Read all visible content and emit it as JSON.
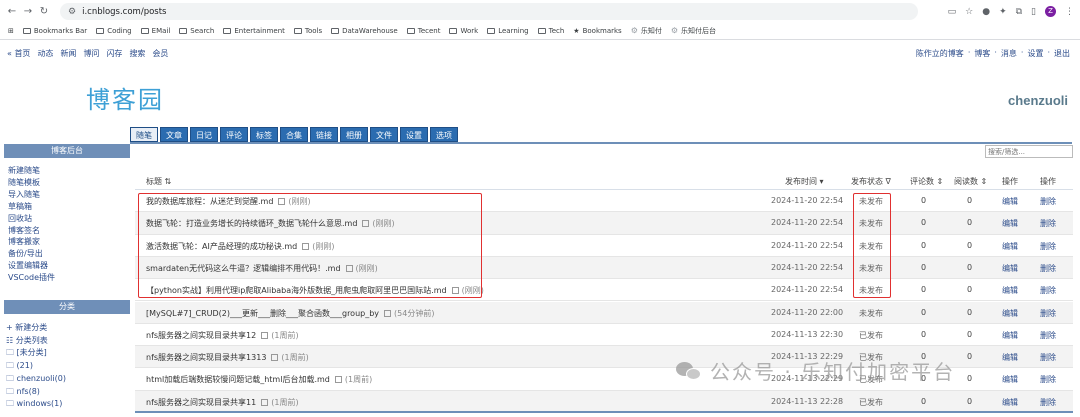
{
  "browser": {
    "url": "i.cnblogs.com/posts",
    "profile_initial": "Z",
    "bookmarks": [
      "Bookmarks Bar",
      "Coding",
      "EMail",
      "Search",
      "Entertainment",
      "Tools",
      "DataWarehouse",
      "Tecent",
      "Work",
      "Learning",
      "Tech",
      "Bookmarks",
      "乐知付",
      "乐知付后台"
    ]
  },
  "site_nav": [
    "« 首页",
    "动态",
    "新闻",
    "博问",
    "闪存",
    "搜索",
    "会员"
  ],
  "top_right": [
    "陈作立的博客",
    "博客",
    "消息",
    "设置",
    "退出"
  ],
  "top_right_sep": "·",
  "logo": "博客园",
  "username": "chenzuoli",
  "tabs": [
    "随笔",
    "文章",
    "日记",
    "评论",
    "标签",
    "合集",
    "链接",
    "相册",
    "文件",
    "设置",
    "选项"
  ],
  "sidebar": {
    "header": "博客后台",
    "links": [
      "新建随笔",
      "随笔模板",
      "导入随笔",
      "草稿箱",
      "回收站",
      "博客签名",
      "博客搬家",
      "备份/导出",
      "设置编辑器",
      "VSCode插件"
    ],
    "category_header": "分类",
    "categories": [
      "+ 新建分类",
      "☷ 分类列表",
      "🗀 [未分类]",
      "🗀 (21)",
      "🗀 chenzuoli(0)",
      "🗀 nfs(8)",
      "🗀 windows(1)"
    ]
  },
  "search": {
    "placeholder": "搜索/筛选..."
  },
  "table": {
    "headers": {
      "title": "标题 ⇅",
      "time": "发布时间 ▾",
      "status": "发布状态 ∇",
      "comments": "评论数 ⇕",
      "reads": "阅读数 ⇕",
      "ops": "操作",
      "ops2": "操作"
    },
    "rows": [
      {
        "title": "我的数据库旅程：从迷茫到觉醒.md",
        "ago": "(刚刚)",
        "time": "2024-11-20 22:54",
        "status": "未发布",
        "comments": "0",
        "reads": "0",
        "edit": "编辑",
        "del": "删除"
      },
      {
        "title": "数据飞轮：打造业务增长的持续循环_数据飞轮什么意思.md",
        "ago": "(刚刚)",
        "time": "2024-11-20 22:54",
        "status": "未发布",
        "comments": "0",
        "reads": "0",
        "edit": "编辑",
        "del": "删除"
      },
      {
        "title": "激活数据飞轮：AI产品经理的成功秘诀.md",
        "ago": "(刚刚)",
        "time": "2024-11-20 22:54",
        "status": "未发布",
        "comments": "0",
        "reads": "0",
        "edit": "编辑",
        "del": "删除"
      },
      {
        "title": "smardaten无代码这么牛逼？逻辑编排不用代码！.md",
        "ago": "(刚刚)",
        "time": "2024-11-20 22:54",
        "status": "未发布",
        "comments": "0",
        "reads": "0",
        "edit": "编辑",
        "del": "删除"
      },
      {
        "title": "【python实战】利用代理ip爬取Alibaba海外版数据_用爬虫爬取阿里巴巴国际站.md",
        "ago": "(刚刚)",
        "time": "2024-11-20 22:54",
        "status": "未发布",
        "comments": "0",
        "reads": "0",
        "edit": "编辑",
        "del": "删除"
      },
      {
        "title": "[MySQL#7]_CRUD(2)___更新___删除___聚合函数___group_by",
        "ago": "(54分钟前)",
        "time": "2024-11-20 22:00",
        "status": "未发布",
        "comments": "0",
        "reads": "0",
        "edit": "编辑",
        "del": "删除"
      },
      {
        "title": "nfs服务器之间实现目录共享12",
        "ago": "(1周前)",
        "time": "2024-11-13 22:30",
        "status": "已发布",
        "comments": "0",
        "reads": "0",
        "edit": "编辑",
        "del": "删除"
      },
      {
        "title": "nfs服务器之间实现目录共享1313",
        "ago": "(1周前)",
        "time": "2024-11-13 22:29",
        "status": "已发布",
        "comments": "0",
        "reads": "0",
        "edit": "编辑",
        "del": "删除"
      },
      {
        "title": "html加载后端数据较慢问题记载_html后台加载.md",
        "ago": "(1周前)",
        "time": "2024-11-13 22:29",
        "status": "已发布",
        "comments": "0",
        "reads": "0",
        "edit": "编辑",
        "del": "删除"
      },
      {
        "title": "nfs服务器之间实现目录共享11",
        "ago": "(1周前)",
        "time": "2024-11-13 22:28",
        "status": "已发布",
        "comments": "0",
        "reads": "0",
        "edit": "编辑",
        "del": "删除"
      }
    ]
  },
  "watermark": "公众号 · 乐知付加密平台"
}
